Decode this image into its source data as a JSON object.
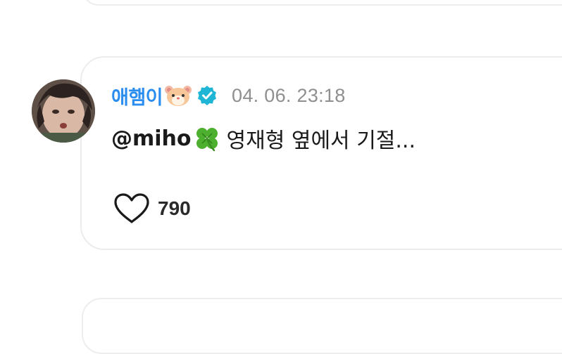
{
  "comment": {
    "username": "애햄이",
    "username_emoji": "hamster-face-icon",
    "verified_badge": "verified-check-icon",
    "timestamp": "04. 06. 23:18",
    "mention": "@miho",
    "mention_emoji": "four-leaf-clover-icon",
    "text": "영재형 옆에서 기절...",
    "like_icon": "heart-outline-icon",
    "like_count": "790"
  },
  "colors": {
    "username": "#2b8def",
    "verified": "#1fb6d6",
    "timestamp": "#8f8f8f",
    "text": "#1a1a1a",
    "border": "#ececec"
  }
}
